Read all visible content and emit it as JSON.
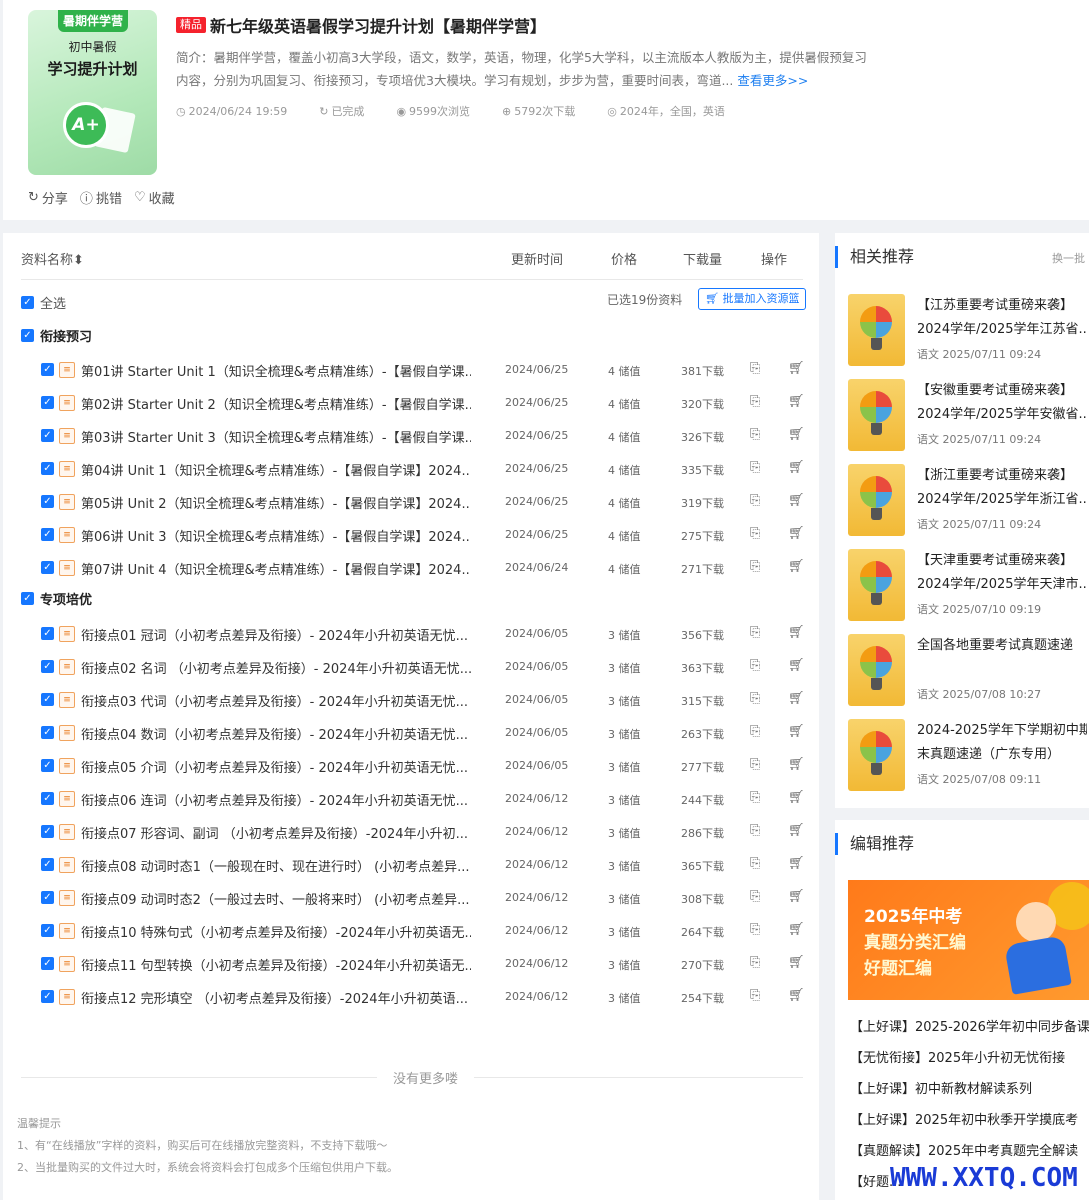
{
  "header": {
    "cover": {
      "tag": "暑期伴学营",
      "line1": "初中暑假",
      "line2": "学习提升计划",
      "badge": "A+"
    },
    "badge": "精品",
    "title": "新七年级英语暑假学习提升计划【暑期伴学营】",
    "intro": "简介：暑期伴学营，覆盖小初高3大学段，语文，数学，英语，物理，化学5大学科，以主流版本人教版为主，提供暑假预复习内容，分别为巩固复习、衔接预习，专项培优3大模块。学习有规划，步步为营，重要时间表，弯道...",
    "more": "查看更多>>",
    "meta": {
      "date": "2024/06/24 19:59",
      "status": "已完成",
      "views": "9599次浏览",
      "downloads": "5792次下载",
      "tags": "2024年，全国，英语"
    },
    "actions": {
      "share": "分享",
      "report": "挑错",
      "fav": "收藏"
    }
  },
  "list": {
    "headers": {
      "name": "资料名称",
      "time": "更新时间",
      "price": "价格",
      "downloads": "下载量",
      "ops": "操作"
    },
    "select_all": "全选",
    "selected_info": "已选19份资料",
    "batch_btn": "批量加入资源篮",
    "groups": [
      {
        "title": "衔接预习"
      },
      {
        "title": "专项培优"
      }
    ],
    "rows": [
      {
        "name": "第01讲 Starter Unit 1（知识全梳理&考点精准练）-【暑假自学课...",
        "date": "2024/06/25",
        "price": "4 储值",
        "dl": "381下载"
      },
      {
        "name": "第02讲 Starter Unit 2（知识全梳理&考点精准练）-【暑假自学课...",
        "date": "2024/06/25",
        "price": "4 储值",
        "dl": "320下载"
      },
      {
        "name": "第03讲 Starter Unit 3（知识全梳理&考点精准练）-【暑假自学课...",
        "date": "2024/06/25",
        "price": "4 储值",
        "dl": "326下载"
      },
      {
        "name": "第04讲 Unit 1（知识全梳理&考点精准练）-【暑假自学课】2024...",
        "date": "2024/06/25",
        "price": "4 储值",
        "dl": "335下载"
      },
      {
        "name": "第05讲 Unit 2（知识全梳理&考点精准练）-【暑假自学课】2024...",
        "date": "2024/06/25",
        "price": "4 储值",
        "dl": "319下载"
      },
      {
        "name": "第06讲 Unit 3（知识全梳理&考点精准练）-【暑假自学课】2024...",
        "date": "2024/06/25",
        "price": "4 储值",
        "dl": "275下载"
      },
      {
        "name": "第07讲 Unit 4（知识全梳理&考点精准练）-【暑假自学课】2024...",
        "date": "2024/06/24",
        "price": "4 储值",
        "dl": "271下载"
      },
      {
        "name": "衔接点01 冠词（小初考点差异及衔接）- 2024年小升初英语无忧...",
        "date": "2024/06/05",
        "price": "3 储值",
        "dl": "356下载"
      },
      {
        "name": "衔接点02 名词 （小初考点差异及衔接）- 2024年小升初英语无忧...",
        "date": "2024/06/05",
        "price": "3 储值",
        "dl": "363下载"
      },
      {
        "name": "衔接点03 代词（小初考点差异及衔接）- 2024年小升初英语无忧...",
        "date": "2024/06/05",
        "price": "3 储值",
        "dl": "315下载"
      },
      {
        "name": "衔接点04 数词（小初考点差异及衔接）- 2024年小升初英语无忧...",
        "date": "2024/06/05",
        "price": "3 储值",
        "dl": "263下载"
      },
      {
        "name": "衔接点05 介词（小初考点差异及衔接）- 2024年小升初英语无忧...",
        "date": "2024/06/05",
        "price": "3 储值",
        "dl": "277下载"
      },
      {
        "name": "衔接点06 连词（小初考点差异及衔接）- 2024年小升初英语无忧...",
        "date": "2024/06/12",
        "price": "3 储值",
        "dl": "244下载"
      },
      {
        "name": "衔接点07 形容词、副词 （小初考点差异及衔接）-2024年小升初...",
        "date": "2024/06/12",
        "price": "3 储值",
        "dl": "286下载"
      },
      {
        "name": "衔接点08 动词时态1（一般现在时、现在进行时） (小初考点差异...",
        "date": "2024/06/12",
        "price": "3 储值",
        "dl": "365下载"
      },
      {
        "name": "衔接点09 动词时态2（一般过去时、一般将来时） (小初考点差异...",
        "date": "2024/06/12",
        "price": "3 储值",
        "dl": "308下载"
      },
      {
        "name": "衔接点10 特殊句式（小初考点差异及衔接）-2024年小升初英语无...",
        "date": "2024/06/12",
        "price": "3 储值",
        "dl": "264下载"
      },
      {
        "name": "衔接点11 句型转换（小初考点差异及衔接）-2024年小升初英语无...",
        "date": "2024/06/12",
        "price": "3 储值",
        "dl": "270下载"
      },
      {
        "name": "衔接点12 完形填空 （小初考点差异及衔接）-2024年小升初英语...",
        "date": "2024/06/12",
        "price": "3 储值",
        "dl": "254下载"
      }
    ],
    "no_more": "没有更多喽",
    "tips": {
      "title": "温馨提示",
      "line1": "1、有“在线播放”字样的资料，购买后可在线播放完整资料，不支持下载哦～",
      "line2": "2、当批量购买的文件过大时，系统会将资料会打包成多个压缩包供用户下载。"
    }
  },
  "sidebar": {
    "related_title": "相关推荐",
    "related_more": "换一批",
    "related": [
      {
        "l1": "【江苏重要考试重磅来袭】",
        "l2": "2024学年/2025学年江苏省...",
        "meta": "语文 2025/07/11 09:24"
      },
      {
        "l1": "【安徽重要考试重磅来袭】",
        "l2": "2024学年/2025学年安徽省...",
        "meta": "语文 2025/07/11 09:24"
      },
      {
        "l1": "【浙江重要考试重磅来袭】",
        "l2": "2024学年/2025学年浙江省...",
        "meta": "语文 2025/07/11 09:24"
      },
      {
        "l1": "【天津重要考试重磅来袭】",
        "l2": "2024学年/2025学年天津市...",
        "meta": "语文 2025/07/10 09:19"
      },
      {
        "l1": "全国各地重要考试真题速递",
        "l2": "",
        "meta": "语文 2025/07/08 10:27"
      },
      {
        "l1": "2024-2025学年下学期初中期",
        "l2": "末真题速递（广东专用）",
        "meta": "语文 2025/07/08 09:11"
      }
    ],
    "editor_title": "编辑推荐",
    "banner": {
      "l1": "2025年中考",
      "l2": "真题分类汇编",
      "l3": "好题汇编"
    },
    "editor_list": [
      "【上好课】2025-2026学年初中同步备课",
      "【无忧衔接】2025年小升初无忧衔接",
      "【上好课】初中新教材解读系列",
      "【上好课】2025年初中秋季开学摸底考",
      "【真题解读】2025年中考真题完全解读",
      "【好题..."
    ]
  },
  "watermark": "WWW.XXTQ.COM"
}
